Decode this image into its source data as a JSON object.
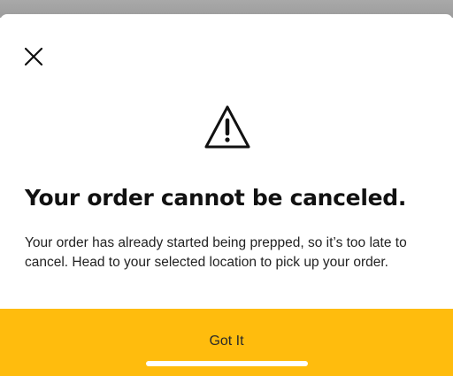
{
  "dialog": {
    "title": "Your order cannot be canceled.",
    "message": "Your order has already started being prepped, so it’s too late to cancel. Head to your selected location to pick up your order.",
    "close_icon": "close-icon",
    "alert_icon": "warning-triangle-icon"
  },
  "actions": {
    "primary_label": "Got It",
    "primary_color": "#ffbc0d"
  },
  "colors": {
    "text": "#111111",
    "background": "#ffffff",
    "backdrop": "#a9a9a9"
  }
}
